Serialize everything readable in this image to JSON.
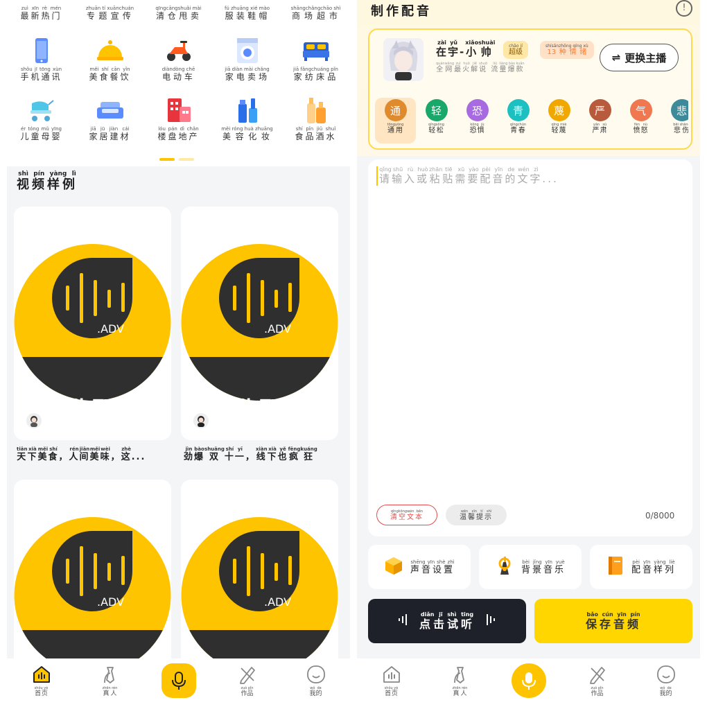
{
  "left": {
    "categories_row0": [
      {
        "label": "最新热门",
        "pinyin": "zuì xīn rè mén"
      },
      {
        "label": "专题宣传",
        "pinyin": "zhuān tí xuānchuán"
      },
      {
        "label": "清仓甩卖",
        "pinyin": "qīngcāngshuǎi mài"
      },
      {
        "label": "服装鞋帽",
        "pinyin": "fú zhuāng xié mào"
      },
      {
        "label": "商场超市",
        "pinyin": "shāngchǎngchāo shì"
      }
    ],
    "categories_row1": [
      {
        "label": "手机通讯",
        "pinyin": "shǒu jī tōng xùn",
        "icon": "phone-icon"
      },
      {
        "label": "美食餐饮",
        "pinyin": "měi shí cān yǐn",
        "icon": "food-cloche-icon"
      },
      {
        "label": "电动车",
        "pinyin": "diàndòng chē",
        "icon": "scooter-icon"
      },
      {
        "label": "家电卖场",
        "pinyin": "jiā diàn mài chǎng",
        "icon": "washing-machine-icon"
      },
      {
        "label": "家纺床品",
        "pinyin": "jiā fǎngchuáng pǐn",
        "icon": "bed-icon"
      }
    ],
    "categories_row2": [
      {
        "label": "儿童母婴",
        "pinyin": "ér tóng mǔ yīng",
        "icon": "stroller-icon"
      },
      {
        "label": "家居建材",
        "pinyin": "jiā jū jiàn cái",
        "icon": "sofa-icon"
      },
      {
        "label": "楼盘地产",
        "pinyin": "lóu pán dì chǎn",
        "icon": "building-icon"
      },
      {
        "label": "美容化妆",
        "pinyin": "měi róng huà zhuāng",
        "icon": "cosmetics-icon"
      },
      {
        "label": "食品酒水",
        "pinyin": "shí pǐn jiǔ shuǐ",
        "icon": "bottles-icon"
      }
    ],
    "section_title": {
      "text": "视频样例",
      "pinyin": "shì pín yàng lì"
    },
    "thumb_text": {
      "adv": ".ADV",
      "banner": "广告配音"
    },
    "cards": [
      {
        "caption": [
          [
            "天",
            "tiān"
          ],
          [
            "下",
            "xià"
          ],
          [
            "美",
            "měi"
          ],
          [
            "食",
            "shí"
          ],
          [
            "，",
            ""
          ],
          [
            "人",
            "rén"
          ],
          [
            "间",
            "jiān"
          ],
          [
            "美",
            "měi"
          ],
          [
            "味",
            "wèi"
          ],
          [
            "，",
            ""
          ],
          [
            "这",
            "zhè"
          ],
          [
            "...",
            ""
          ]
        ]
      },
      {
        "caption": [
          [
            "劲",
            "jìn"
          ],
          [
            "爆",
            "bào"
          ],
          [
            "双",
            "shuāng"
          ],
          [
            "十",
            "shí"
          ],
          [
            "一",
            "yī"
          ],
          [
            "，",
            ""
          ],
          [
            "线",
            "xiàn"
          ],
          [
            "下",
            "xià"
          ],
          [
            "也",
            "yě"
          ],
          [
            "疯",
            "fēng"
          ],
          [
            "狂",
            "kuáng"
          ]
        ]
      }
    ]
  },
  "nav": [
    {
      "label": "首页",
      "pinyin": "shǒu yè",
      "icon": "home-wave-icon"
    },
    {
      "label": "真人",
      "pinyin": "zhēn rén",
      "icon": "person-tie-icon"
    },
    {
      "label": "",
      "pinyin": "",
      "icon": "microphone-icon"
    },
    {
      "label": "作品",
      "pinyin": "zuò pǐn",
      "icon": "pencil-ruler-icon"
    },
    {
      "label": "我的",
      "pinyin": "wǒ de",
      "icon": "smile-face-icon"
    }
  ],
  "right": {
    "title": "制作配音",
    "info": "!",
    "voice": {
      "name": [
        [
          "在",
          "zài"
        ],
        [
          "宇",
          "yǔ"
        ],
        [
          "-",
          ""
        ],
        [
          "小",
          "xiǎo"
        ],
        [
          "帅",
          "shuài"
        ]
      ],
      "vip": {
        "text": "超级",
        "pinyin": "chāo jí"
      },
      "emotions_badge": {
        "text": "13种情绪",
        "pinyin": "shísānzhǒng qíng xù"
      },
      "sub": [
        [
          "全",
          "quán"
        ],
        [
          "网",
          "wǎng"
        ],
        [
          "最",
          "zuì"
        ],
        [
          "火",
          "huǒ"
        ],
        [
          "解",
          "jiě"
        ],
        [
          "说",
          "shuō"
        ],
        [
          " ",
          ""
        ],
        [
          "流",
          "liú"
        ],
        [
          "量",
          "liàng"
        ],
        [
          "爆",
          "bào"
        ],
        [
          "款",
          "kuǎn"
        ]
      ],
      "switch_label": "更换主播"
    },
    "emotions": [
      {
        "char": "通",
        "label": "通用",
        "pinyin": "tōngyòng",
        "color": "#e08a2e"
      },
      {
        "char": "轻",
        "label": "轻松",
        "pinyin": "qīngsōng",
        "color": "#1aa86a"
      },
      {
        "char": "恐",
        "label": "恐惧",
        "pinyin": "kǒng jù",
        "color": "#a86ae0"
      },
      {
        "char": "青",
        "label": "青春",
        "pinyin": "qīngchūn",
        "color": "#1cc0c0"
      },
      {
        "char": "蔑",
        "label": "轻蔑",
        "pinyin": "qīng miè",
        "color": "#f0a800"
      },
      {
        "char": "严",
        "label": "严肃",
        "pinyin": "yán sù",
        "color": "#b85a3c"
      },
      {
        "char": "气",
        "label": "愤怒",
        "pinyin": "fèn nù",
        "color": "#f07850"
      },
      {
        "char": "悲",
        "label": "悲伤",
        "pinyin": "bēi shāng",
        "color": "#3c8a9a"
      }
    ],
    "placeholder": [
      [
        "请",
        "qǐng"
      ],
      [
        "输",
        "shū"
      ],
      [
        "入",
        "rù"
      ],
      [
        "或",
        "huò"
      ],
      [
        "粘",
        "zhān"
      ],
      [
        "贴",
        "tiē"
      ],
      [
        "需",
        "xū"
      ],
      [
        "要",
        "yào"
      ],
      [
        "配",
        "pèi"
      ],
      [
        "音",
        "yīn"
      ],
      [
        "的",
        "de"
      ],
      [
        "文",
        "wén"
      ],
      [
        "字",
        "zì"
      ],
      [
        "...",
        ""
      ]
    ],
    "clear_text": {
      "text": "清空文本",
      "pinyin": "qīngkōngwén běn"
    },
    "tips": {
      "text": "温馨提示",
      "pinyin": "wēn xīn tí shì"
    },
    "counter": "0/8000",
    "options": [
      {
        "text": "声音设置",
        "pinyin": "shēng yīn shè zhì",
        "icon": "cube-icon"
      },
      {
        "text": "背景音乐",
        "pinyin": "bèi jǐng yīn yuè",
        "icon": "music-note-icon"
      },
      {
        "text": "配音样列",
        "pinyin": "pèi yīn yàng liè",
        "icon": "book-icon"
      }
    ],
    "listen": {
      "text": "点击试听",
      "pinyin": "diǎn jī shì tīng"
    },
    "save": {
      "text": "保存音频",
      "pinyin": "bǎo cún yīn pín"
    }
  },
  "colors": {
    "accent": "#ffc400",
    "dark": "#1e2129",
    "save": "#ffd600",
    "clear": "#e74c4c"
  }
}
